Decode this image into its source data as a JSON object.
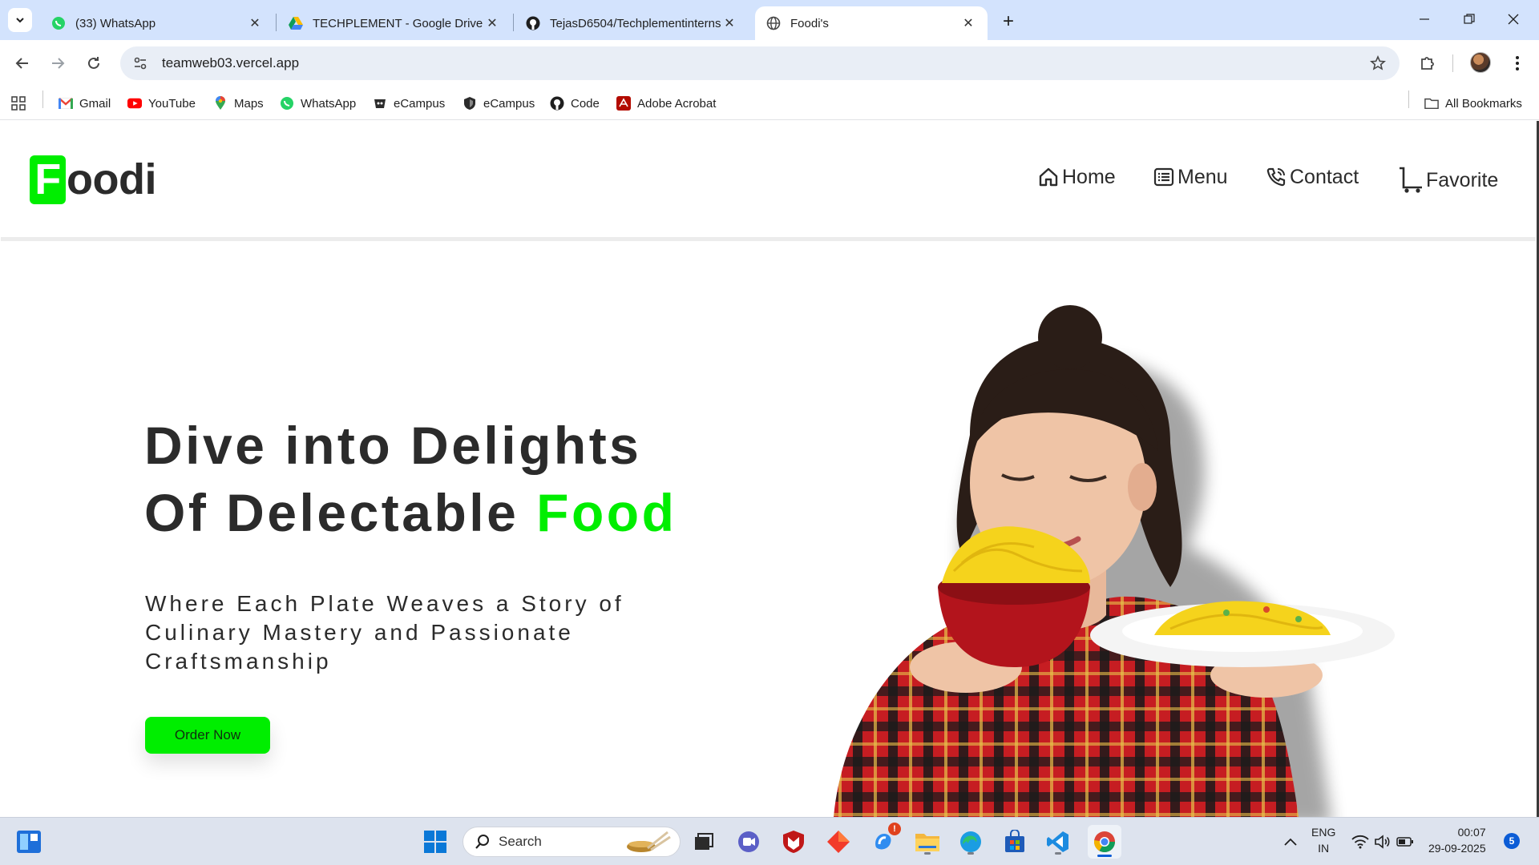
{
  "browser": {
    "tabs": [
      {
        "title": "(33) WhatsApp",
        "icon": "whatsapp-icon",
        "active": false
      },
      {
        "title": "TECHPLEMENT - Google Drive",
        "icon": "google-drive-icon",
        "active": false
      },
      {
        "title": "TejasD6504/Techplementinterns",
        "icon": "github-icon",
        "active": false
      },
      {
        "title": "Foodi's",
        "icon": "globe-icon",
        "active": true
      }
    ],
    "url": "teamweb03.vercel.app",
    "bookmarks": [
      {
        "label": "Gmail",
        "icon": "gmail-icon"
      },
      {
        "label": "YouTube",
        "icon": "youtube-icon"
      },
      {
        "label": "Maps",
        "icon": "maps-icon"
      },
      {
        "label": "WhatsApp",
        "icon": "whatsapp-icon"
      },
      {
        "label": "eCampus",
        "icon": "ecampus-icon"
      },
      {
        "label": "eCampus",
        "icon": "shield-icon"
      },
      {
        "label": "Code",
        "icon": "github-icon"
      },
      {
        "label": "Adobe Acrobat",
        "icon": "acrobat-icon"
      }
    ],
    "all_bookmarks": "All Bookmarks"
  },
  "site": {
    "logo_first": "F",
    "logo_rest": "oodi",
    "nav": [
      {
        "label": "Home",
        "icon": "home-icon"
      },
      {
        "label": "Menu",
        "icon": "menu-list-icon"
      },
      {
        "label": "Contact",
        "icon": "phone-icon"
      },
      {
        "label": "Favorite",
        "icon": "cart-icon"
      }
    ],
    "hero": {
      "line1": "Dive into Delights",
      "line2_start": "Of Delectable ",
      "line2_accent": "Food",
      "subtitle": "Where Each Plate Weaves a Story of Culinary Mastery and Passionate Craftsmanship",
      "cta": "Order Now"
    },
    "colors": {
      "accent": "#00ee00",
      "text": "#2b2b2b"
    }
  },
  "taskbar": {
    "search_placeholder": "Search",
    "lang_top": "ENG",
    "lang_bottom": "IN",
    "time": "00:07",
    "date": "29-09-2025",
    "notification_count": "5",
    "copilot_badge": "!"
  }
}
